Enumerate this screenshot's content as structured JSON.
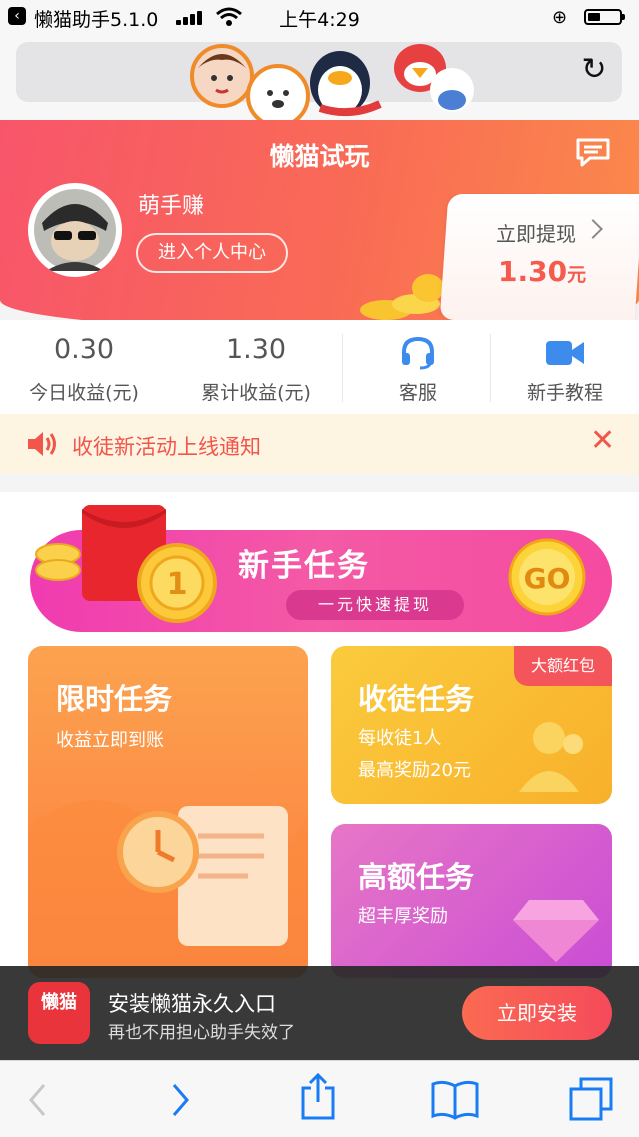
{
  "status_bar": {
    "back_app": "懒猫助手5.1.0",
    "time": "上午4:29"
  },
  "icons": {
    "back": "back-arrow-icon",
    "reload": "reload-icon",
    "message": "message-icon",
    "customer_service": "headset-icon",
    "tutorial": "video-icon",
    "notice": "speaker-icon",
    "close": "close-icon"
  },
  "header": {
    "title": "懒猫试玩",
    "nickname": "萌手赚",
    "center_button": "进入个人中心",
    "withdraw_label": "立即提现",
    "withdraw_amount": "1.30",
    "withdraw_unit": "元"
  },
  "stats": {
    "today_value": "0.30",
    "today_label": "今日收益(元)",
    "total_value": "1.30",
    "total_label": "累计收益(元)",
    "service_label": "客服",
    "tutorial_label": "新手教程"
  },
  "notice": {
    "text": "收徒新活动上线通知"
  },
  "banner": {
    "title": "新手任务",
    "subtitle": "一元快速提现",
    "coin_text": "1",
    "go_text": "GO"
  },
  "cards": {
    "limited": {
      "title": "限时任务",
      "subtitle": "收益立即到账"
    },
    "apprentice": {
      "title": "收徒任务",
      "line1": "每收徒1人",
      "line2": "最高奖励20元",
      "tag": "大额红包"
    },
    "high": {
      "title": "高额任务",
      "subtitle": "超丰厚奖励"
    }
  },
  "install": {
    "app_name": "懒猫",
    "title": "安装懒猫永久入口",
    "subtitle": "再也不用担心助手失效了",
    "button": "立即安装"
  },
  "colors": {
    "brand": "#f8556a",
    "accent_text": "#f2564a",
    "banner_pink": "#f03bb0",
    "card_orange": "#fb8a40",
    "card_yellow": "#fbc036",
    "card_purple": "#d45fcf"
  }
}
